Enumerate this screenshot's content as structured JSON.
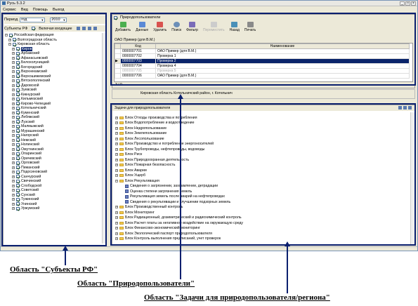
{
  "app": {
    "title": "Русь 5.3.2"
  },
  "menu": [
    "Сервис",
    "Вид",
    "Помощь",
    "Выход"
  ],
  "period": {
    "label": "Период",
    "type_value": "год",
    "year_value": "2010"
  },
  "subjects": {
    "tab_label": "Субъекты РФ",
    "include_label": "Включая входящие",
    "items": [
      {
        "label": "Российская федерация",
        "level": 0,
        "checked": true,
        "pm": "-"
      },
      {
        "label": "Волгоградская область",
        "level": 1,
        "checked": true,
        "pm": "+"
      },
      {
        "label": "Кировская область",
        "level": 1,
        "checked": true,
        "pm": "-"
      },
      {
        "label": "Киров",
        "level": 2,
        "checked": true,
        "pm": "+",
        "selected": true
      },
      {
        "label": "Арбажский",
        "level": 2,
        "checked": true,
        "pm": "+"
      },
      {
        "label": "Афанасьевский",
        "level": 2,
        "checked": true,
        "pm": "+"
      },
      {
        "label": "Белохолуницкий",
        "level": 2,
        "checked": true,
        "pm": "+"
      },
      {
        "label": "Богородский",
        "level": 2,
        "checked": true,
        "pm": "+"
      },
      {
        "label": "Верхнекамский",
        "level": 2,
        "checked": true,
        "pm": "+"
      },
      {
        "label": "Верхошижемский",
        "level": 2,
        "checked": true,
        "pm": "+"
      },
      {
        "label": "Вятскополянский",
        "level": 2,
        "checked": true,
        "pm": "+"
      },
      {
        "label": "Даровской",
        "level": 2,
        "checked": true,
        "pm": "+"
      },
      {
        "label": "Зуевский",
        "level": 2,
        "checked": true,
        "pm": "+"
      },
      {
        "label": "Кикнурский",
        "level": 2,
        "checked": true,
        "pm": "+"
      },
      {
        "label": "Кильмезский",
        "level": 2,
        "checked": true,
        "pm": "+"
      },
      {
        "label": "Кирово-Чепецкий",
        "level": 2,
        "checked": true,
        "pm": "+"
      },
      {
        "label": "Котельничский",
        "level": 2,
        "checked": true,
        "pm": "+"
      },
      {
        "label": "Куменский",
        "level": 2,
        "checked": true,
        "pm": "+"
      },
      {
        "label": "Лебяжский",
        "level": 2,
        "checked": true,
        "pm": "+"
      },
      {
        "label": "Лузский",
        "level": 2,
        "checked": true,
        "pm": "+"
      },
      {
        "label": "Малмыжский",
        "level": 2,
        "checked": true,
        "pm": "+"
      },
      {
        "label": "Мурашинский",
        "level": 2,
        "checked": true,
        "pm": "+"
      },
      {
        "label": "Нагорский",
        "level": 2,
        "checked": true,
        "pm": "+"
      },
      {
        "label": "Немский",
        "level": 2,
        "checked": true,
        "pm": "+"
      },
      {
        "label": "Нолинский",
        "level": 2,
        "checked": true,
        "pm": "+"
      },
      {
        "label": "Омутнинский",
        "level": 2,
        "checked": true,
        "pm": "+"
      },
      {
        "label": "Опаринский",
        "level": 2,
        "checked": true,
        "pm": "+"
      },
      {
        "label": "Оричевский",
        "level": 2,
        "checked": true,
        "pm": "+"
      },
      {
        "label": "Орловский",
        "level": 2,
        "checked": true,
        "pm": "+"
      },
      {
        "label": "Пижанский",
        "level": 2,
        "checked": true,
        "pm": "+"
      },
      {
        "label": "Подосиновский",
        "level": 2,
        "checked": true,
        "pm": "+"
      },
      {
        "label": "Санчурский",
        "level": 2,
        "checked": true,
        "pm": "+"
      },
      {
        "label": "Свечинский",
        "level": 2,
        "checked": true,
        "pm": "+"
      },
      {
        "label": "Слободской",
        "level": 2,
        "checked": true,
        "pm": "+"
      },
      {
        "label": "Советский",
        "level": 2,
        "checked": true,
        "pm": "+"
      },
      {
        "label": "Сунский",
        "level": 2,
        "checked": true,
        "pm": "+"
      },
      {
        "label": "Тужинский",
        "level": 2,
        "checked": true,
        "pm": "+"
      },
      {
        "label": "Унинский",
        "level": 2,
        "checked": true,
        "pm": "+"
      },
      {
        "label": "Уржумский",
        "level": 2,
        "checked": true,
        "pm": "+"
      }
    ]
  },
  "users": {
    "tab_label": "Природопользователи",
    "toolbar": [
      "Добавить",
      "Данные",
      "Удалить",
      "Поиск",
      "Фильтр",
      "Переместить",
      "Назад",
      "Печать"
    ],
    "toolbar_disabled": [
      false,
      false,
      false,
      false,
      false,
      true,
      false,
      false
    ],
    "breadcrumb": "ОАО Пример (для В.М.)",
    "columns": [
      "Код",
      "Наименование"
    ],
    "rows": [
      {
        "code": "0000007701",
        "name": "ОАО Пример (для В.М.)",
        "selected": false,
        "greyed": false
      },
      {
        "code": "0000007702",
        "name": "Проверка 1",
        "selected": false,
        "greyed": false
      },
      {
        "code": "0000007703",
        "name": "Проверка 2",
        "selected": true,
        "greyed": false
      },
      {
        "code": "0000007704",
        "name": "Проверка 4",
        "selected": false,
        "greyed": false
      },
      {
        "code": "0000007705",
        "name": "Проверка 5",
        "selected": false,
        "greyed": true
      },
      {
        "code": "0000007706",
        "name": "ОАО Пример (для В.М.)",
        "selected": false,
        "greyed": false
      }
    ],
    "counter": "3 / 9",
    "address": "Кировская область Котельничский район, г. Котельнич"
  },
  "tasks": {
    "tab_label": "Задачи для природопользователя",
    "items": [
      {
        "label": "Блок Отходы производства и потребления",
        "level": 0,
        "kind": "folder"
      },
      {
        "label": "Блок Водопотребление и водоотведение",
        "level": 0,
        "kind": "folder"
      },
      {
        "label": "Блок Недропользование",
        "level": 0,
        "kind": "folder"
      },
      {
        "label": "Блок Землепользование",
        "level": 0,
        "kind": "folder"
      },
      {
        "label": "Блок Лесопользование",
        "level": 0,
        "kind": "folder"
      },
      {
        "label": "Блок Производство и потребление энергоносителей",
        "level": 0,
        "kind": "folder"
      },
      {
        "label": "Блок Трубопроводы, нефтепроводы, водоводы",
        "level": 0,
        "kind": "folder"
      },
      {
        "label": "Блок Риск",
        "level": 0,
        "kind": "folder"
      },
      {
        "label": "Блок Природоохранная деятельность",
        "level": 0,
        "kind": "folder"
      },
      {
        "label": "Блок Пожарная безопасность",
        "level": 0,
        "kind": "folder"
      },
      {
        "label": "Блок Аварии",
        "level": 0,
        "kind": "folder"
      },
      {
        "label": "Блок Ущерб",
        "level": 0,
        "kind": "folder"
      },
      {
        "label": "Блок Рекультивация",
        "level": 0,
        "kind": "folder",
        "open": true
      },
      {
        "label": "Сведения о загрязнении, захламлении, деградации",
        "level": 1,
        "kind": "doc"
      },
      {
        "label": "Оценка степени загрязнения земель",
        "level": 1,
        "kind": "doc"
      },
      {
        "label": "Рекультивация земель после аварий на нефтепроводах",
        "level": 1,
        "kind": "doc"
      },
      {
        "label": "Сведения о рекультивации и улучшении подзорных земель",
        "level": 1,
        "kind": "doc"
      },
      {
        "label": "Блок Производственный контроль",
        "level": 0,
        "kind": "folder"
      },
      {
        "label": "Блок Мониторинг",
        "level": 0,
        "kind": "folder"
      },
      {
        "label": "Блок Радиационный, дозиметрический и радиохимический контроль",
        "level": 0,
        "kind": "folder"
      },
      {
        "label": "Блок Расчет платы за негативное воздействие на окружающую среду",
        "level": 0,
        "kind": "folder"
      },
      {
        "label": "Блок Финансово-экономический мониторинг",
        "level": 0,
        "kind": "folder"
      },
      {
        "label": "Блок Экологический паспорт природопользователя",
        "level": 0,
        "kind": "folder"
      },
      {
        "label": "Блок Контроль выполнения предписаний, учет проверок",
        "level": 0,
        "kind": "folder"
      }
    ]
  },
  "annotations": {
    "subjects": "Область \"Субъекты РФ\"",
    "users": "Область \"Природопользователи\"",
    "tasks": "Область \"Задачи для природопользователя/региона\""
  },
  "colors": {
    "frame": "#0a1f6e",
    "selection": "#0a246a",
    "folder": "#f2c94c"
  }
}
